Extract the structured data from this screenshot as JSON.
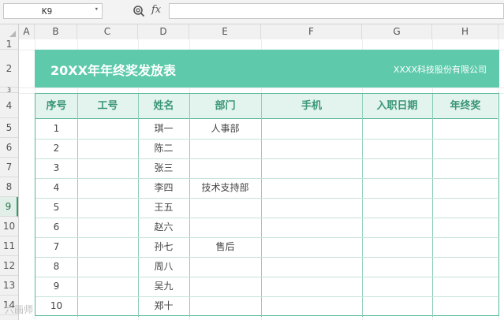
{
  "formula_bar": {
    "name_box": "K9",
    "name_box_arrow": "▾",
    "fx_label": "fx",
    "formula_value": ""
  },
  "columns": [
    "A",
    "B",
    "C",
    "D",
    "E",
    "F",
    "G",
    "H"
  ],
  "rows": [
    "1",
    "2",
    "3",
    "4",
    "5",
    "6",
    "7",
    "8",
    "9",
    "10",
    "11",
    "12",
    "13",
    "14"
  ],
  "selected_row": "9",
  "banner": {
    "title": "20XX年年终奖发放表",
    "company": "XXXX科技股份有限公司",
    "color": "#5ecaab"
  },
  "table": {
    "headers": [
      "序号",
      "工号",
      "姓名",
      "部门",
      "手机",
      "入职日期",
      "年终奖"
    ],
    "rows": [
      {
        "no": "1",
        "id": "",
        "name": "琪一",
        "dept": "人事部",
        "phone": "",
        "date": "",
        "bonus": ""
      },
      {
        "no": "2",
        "id": "",
        "name": "陈二",
        "dept": "",
        "phone": "",
        "date": "",
        "bonus": ""
      },
      {
        "no": "3",
        "id": "",
        "name": "张三",
        "dept": "",
        "phone": "",
        "date": "",
        "bonus": ""
      },
      {
        "no": "4",
        "id": "",
        "name": "李四",
        "dept": "技术支持部",
        "phone": "",
        "date": "",
        "bonus": ""
      },
      {
        "no": "5",
        "id": "",
        "name": "王五",
        "dept": "",
        "phone": "",
        "date": "",
        "bonus": ""
      },
      {
        "no": "6",
        "id": "",
        "name": "赵六",
        "dept": "",
        "phone": "",
        "date": "",
        "bonus": ""
      },
      {
        "no": "7",
        "id": "",
        "name": "孙七",
        "dept": "售后",
        "phone": "",
        "date": "",
        "bonus": ""
      },
      {
        "no": "8",
        "id": "",
        "name": "周八",
        "dept": "",
        "phone": "",
        "date": "",
        "bonus": ""
      },
      {
        "no": "9",
        "id": "",
        "name": "吴九",
        "dept": "",
        "phone": "",
        "date": "",
        "bonus": ""
      },
      {
        "no": "10",
        "id": "",
        "name": "郑十",
        "dept": "",
        "phone": "",
        "date": "",
        "bonus": ""
      }
    ],
    "header_color": "#3a9678",
    "border_color": "#57b896"
  },
  "watermark": "六画师"
}
